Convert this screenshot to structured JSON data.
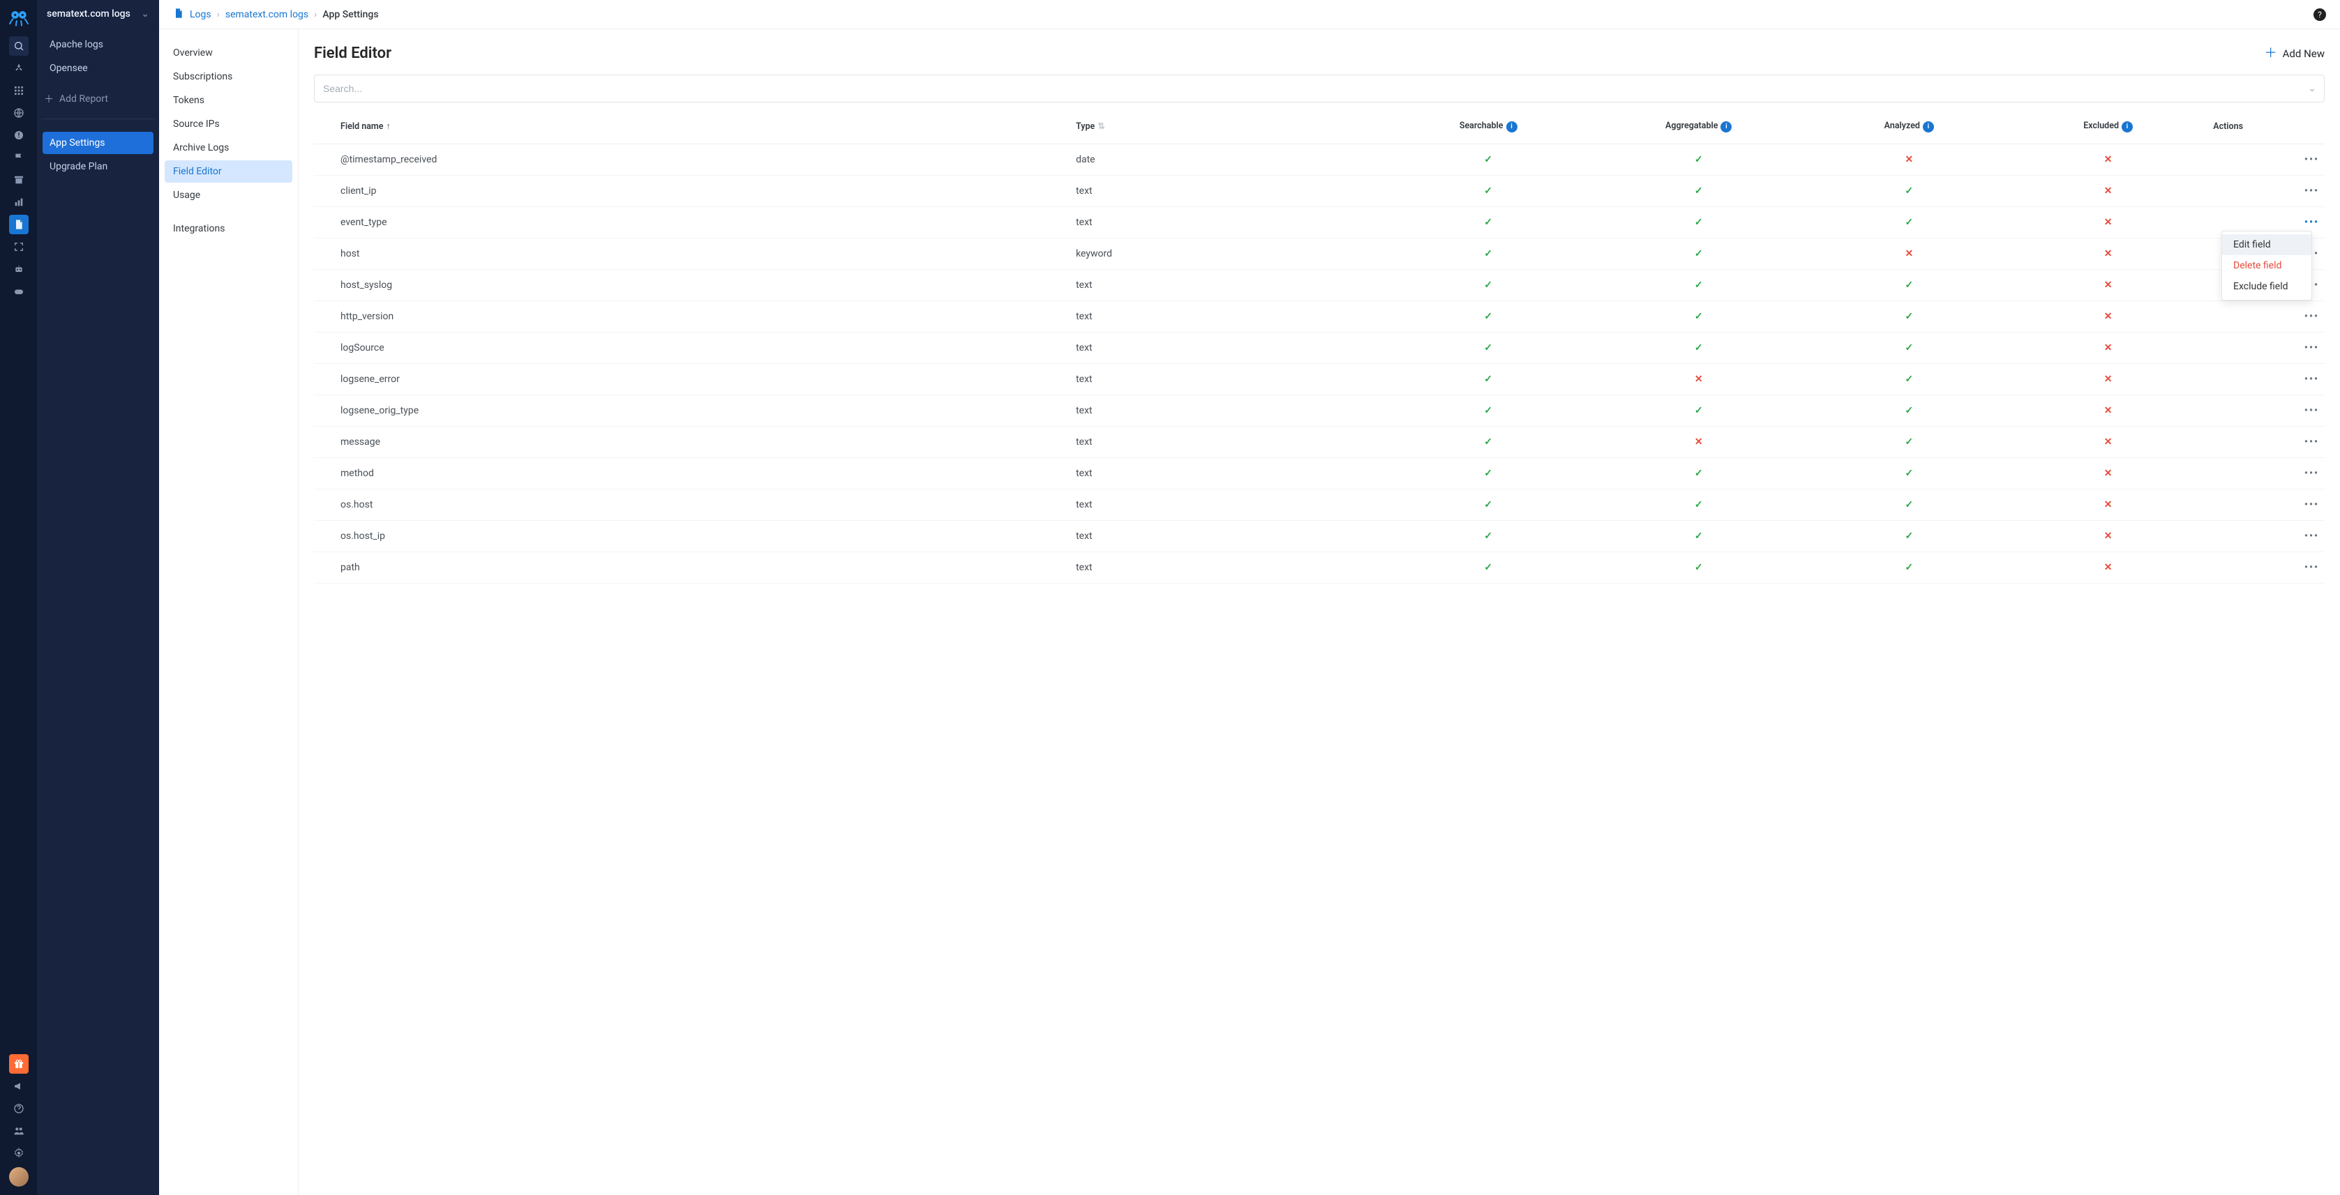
{
  "app_title": "sematext.com logs",
  "sidebar": {
    "items": [
      {
        "label": "Apache logs"
      },
      {
        "label": "Opensee"
      }
    ],
    "add_report_label": "Add Report",
    "bottom_items": [
      {
        "label": "App Settings",
        "active": true
      },
      {
        "label": "Upgrade Plan"
      }
    ]
  },
  "settings_nav": {
    "groups": [
      {
        "items": [
          "Overview",
          "Subscriptions",
          "Tokens",
          "Source IPs",
          "Archive Logs",
          "Field Editor",
          "Usage"
        ],
        "active_index": 5
      },
      {
        "items": [
          "Integrations"
        ]
      }
    ]
  },
  "breadcrumbs": {
    "links": [
      "Logs",
      "sematext.com logs"
    ],
    "current": "App Settings"
  },
  "page": {
    "title": "Field Editor",
    "add_new_label": "Add New"
  },
  "search": {
    "placeholder": "Search..."
  },
  "columns": {
    "field_name": "Field name",
    "type": "Type",
    "searchable": "Searchable",
    "aggregatable": "Aggregatable",
    "analyzed": "Analyzed",
    "excluded": "Excluded",
    "actions": "Actions"
  },
  "context_menu": {
    "edit": "Edit field",
    "delete": "Delete field",
    "exclude": "Exclude field",
    "open_row_index": 2
  },
  "rows": [
    {
      "name": "@timestamp_received",
      "type": "date",
      "searchable": true,
      "aggregatable": true,
      "analyzed": false,
      "excluded": false
    },
    {
      "name": "client_ip",
      "type": "text",
      "searchable": true,
      "aggregatable": true,
      "analyzed": true,
      "excluded": false
    },
    {
      "name": "event_type",
      "type": "text",
      "searchable": true,
      "aggregatable": true,
      "analyzed": true,
      "excluded": false
    },
    {
      "name": "host",
      "type": "keyword",
      "searchable": true,
      "aggregatable": true,
      "analyzed": false,
      "excluded": false
    },
    {
      "name": "host_syslog",
      "type": "text",
      "searchable": true,
      "aggregatable": true,
      "analyzed": true,
      "excluded": false
    },
    {
      "name": "http_version",
      "type": "text",
      "searchable": true,
      "aggregatable": true,
      "analyzed": true,
      "excluded": false
    },
    {
      "name": "logSource",
      "type": "text",
      "searchable": true,
      "aggregatable": true,
      "analyzed": true,
      "excluded": false
    },
    {
      "name": "logsene_error",
      "type": "text",
      "searchable": true,
      "aggregatable": false,
      "analyzed": true,
      "excluded": false
    },
    {
      "name": "logsene_orig_type",
      "type": "text",
      "searchable": true,
      "aggregatable": true,
      "analyzed": true,
      "excluded": false
    },
    {
      "name": "message",
      "type": "text",
      "searchable": true,
      "aggregatable": false,
      "analyzed": true,
      "excluded": false
    },
    {
      "name": "method",
      "type": "text",
      "searchable": true,
      "aggregatable": true,
      "analyzed": true,
      "excluded": false
    },
    {
      "name": "os.host",
      "type": "text",
      "searchable": true,
      "aggregatable": true,
      "analyzed": true,
      "excluded": false
    },
    {
      "name": "os.host_ip",
      "type": "text",
      "searchable": true,
      "aggregatable": true,
      "analyzed": true,
      "excluded": false
    },
    {
      "name": "path",
      "type": "text",
      "searchable": true,
      "aggregatable": true,
      "analyzed": true,
      "excluded": false
    }
  ]
}
